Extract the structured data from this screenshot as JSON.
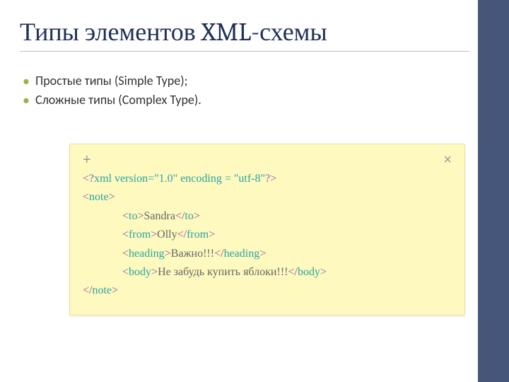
{
  "title": "Типы элементов XML-схемы",
  "bullets": [
    "Простые типы (Simple Type);",
    "Сложные типы (Complex Type)."
  ],
  "note": {
    "add_label": "+",
    "close_label": "×",
    "lines": [
      {
        "indent": false,
        "spans": [
          {
            "cls": "purple",
            "t": "<?"
          },
          {
            "cls": "teal",
            "t": "xml version=\"1.0\" encoding = \"utf-8\""
          },
          {
            "cls": "purple",
            "t": "?>"
          }
        ]
      },
      {
        "indent": false,
        "spans": [
          {
            "cls": "purple",
            "t": "<"
          },
          {
            "cls": "teal",
            "t": "note"
          },
          {
            "cls": "purple",
            "t": ">"
          }
        ]
      },
      {
        "indent": true,
        "spans": [
          {
            "cls": "purple",
            "t": "<"
          },
          {
            "cls": "teal",
            "t": "to"
          },
          {
            "cls": "purple",
            "t": ">"
          },
          {
            "cls": "",
            "t": "Sandra"
          },
          {
            "cls": "purple",
            "t": "</"
          },
          {
            "cls": "teal",
            "t": "to"
          },
          {
            "cls": "purple",
            "t": ">"
          }
        ]
      },
      {
        "indent": true,
        "spans": [
          {
            "cls": "purple",
            "t": "<"
          },
          {
            "cls": "teal",
            "t": "from"
          },
          {
            "cls": "purple",
            "t": ">"
          },
          {
            "cls": "",
            "t": "Olly"
          },
          {
            "cls": "purple",
            "t": "</"
          },
          {
            "cls": "teal",
            "t": "from"
          },
          {
            "cls": "purple",
            "t": ">"
          }
        ]
      },
      {
        "indent": true,
        "spans": [
          {
            "cls": "purple",
            "t": "<"
          },
          {
            "cls": "teal",
            "t": "heading"
          },
          {
            "cls": "purple",
            "t": ">"
          },
          {
            "cls": "",
            "t": "Важно!!!"
          },
          {
            "cls": "purple",
            "t": "</"
          },
          {
            "cls": "teal",
            "t": "heading"
          },
          {
            "cls": "purple",
            "t": ">"
          }
        ]
      },
      {
        "indent": true,
        "spans": [
          {
            "cls": "purple",
            "t": "<"
          },
          {
            "cls": "teal",
            "t": "body"
          },
          {
            "cls": "purple",
            "t": ">"
          },
          {
            "cls": "",
            "t": "Не забудь купить яблоки!!!"
          },
          {
            "cls": "purple",
            "t": "</"
          },
          {
            "cls": "teal",
            "t": "body"
          },
          {
            "cls": "purple",
            "t": ">"
          }
        ]
      },
      {
        "indent": false,
        "spans": [
          {
            "cls": "purple",
            "t": "</"
          },
          {
            "cls": "teal",
            "t": "note"
          },
          {
            "cls": "purple",
            "t": ">"
          }
        ]
      }
    ]
  }
}
